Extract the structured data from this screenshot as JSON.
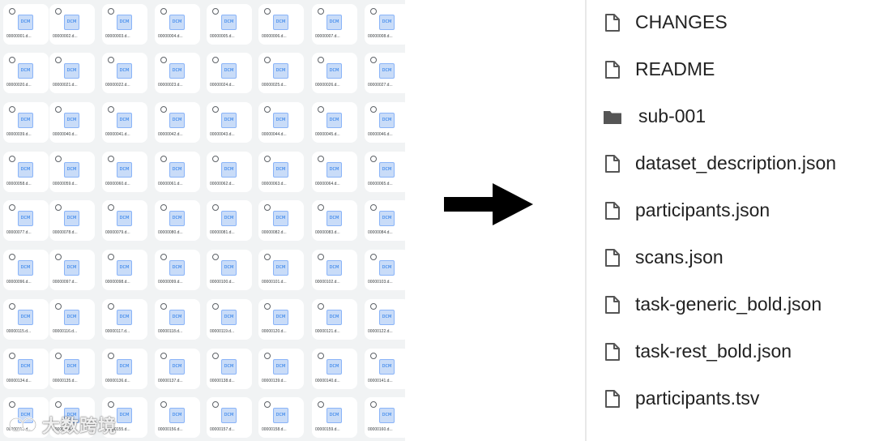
{
  "dicom_grid": {
    "icon_label": "DCM",
    "rows": [
      [
        "00000001.d...",
        "00000002.d...",
        "00000003.d...",
        "00000004.d...",
        "00000005.d...",
        "00000006.d...",
        "00000007.d...",
        "00000008.d..."
      ],
      [
        "00000020.d...",
        "00000021.d...",
        "00000022.d...",
        "00000023.d...",
        "00000024.d...",
        "00000025.d...",
        "00000026.d...",
        "00000027.d..."
      ],
      [
        "00000039.d...",
        "00000040.d...",
        "00000041.d...",
        "00000042.d...",
        "00000043.d...",
        "00000044.d...",
        "00000045.d...",
        "00000046.d..."
      ],
      [
        "00000058.d...",
        "00000059.d...",
        "00000060.d...",
        "00000061.d...",
        "00000062.d...",
        "00000063.d...",
        "00000064.d...",
        "00000065.d..."
      ],
      [
        "00000077.d...",
        "00000078.d...",
        "00000079.d...",
        "00000080.d...",
        "00000081.d...",
        "00000082.d...",
        "00000083.d...",
        "00000084.d..."
      ],
      [
        "00000096.d...",
        "00000097.d...",
        "00000098.d...",
        "00000099.d...",
        "00000100.d...",
        "00000101.d...",
        "00000102.d...",
        "00000103.d..."
      ],
      [
        "00000115.d...",
        "00000116.d...",
        "00000117.d...",
        "00000118.d...",
        "00000119.d...",
        "00000120.d...",
        "00000121.d...",
        "00000122.d..."
      ],
      [
        "00000134.d...",
        "00000135.d...",
        "00000136.d...",
        "00000137.d...",
        "00000138.d...",
        "00000139.d...",
        "00000140.d...",
        "00000141.d..."
      ],
      [
        "00000153.d...",
        "00000154.d...",
        "00000155.d...",
        "00000156.d...",
        "00000157.d...",
        "00000158.d...",
        "00000159.d...",
        "00000160.d..."
      ]
    ]
  },
  "watermark": {
    "text": "大数跨境"
  },
  "arrow": {
    "icon": "arrow-right-icon",
    "color": "#000000"
  },
  "bids_list": {
    "items": [
      {
        "name": "CHANGES",
        "type": "file"
      },
      {
        "name": "README",
        "type": "file"
      },
      {
        "name": "sub-001",
        "type": "folder"
      },
      {
        "name": "dataset_description.json",
        "type": "file"
      },
      {
        "name": "participants.json",
        "type": "file"
      },
      {
        "name": "scans.json",
        "type": "file"
      },
      {
        "name": "task-generic_bold.json",
        "type": "file"
      },
      {
        "name": "task-rest_bold.json",
        "type": "file"
      },
      {
        "name": "participants.tsv",
        "type": "file"
      }
    ]
  },
  "colors": {
    "grid_background": "#f1f3f4",
    "tile_background": "#ffffff",
    "dicom_icon_fill": "#c9dcf8",
    "dicom_icon_text": "#1a73e8",
    "list_icon": "#555555",
    "list_text": "#222222"
  }
}
